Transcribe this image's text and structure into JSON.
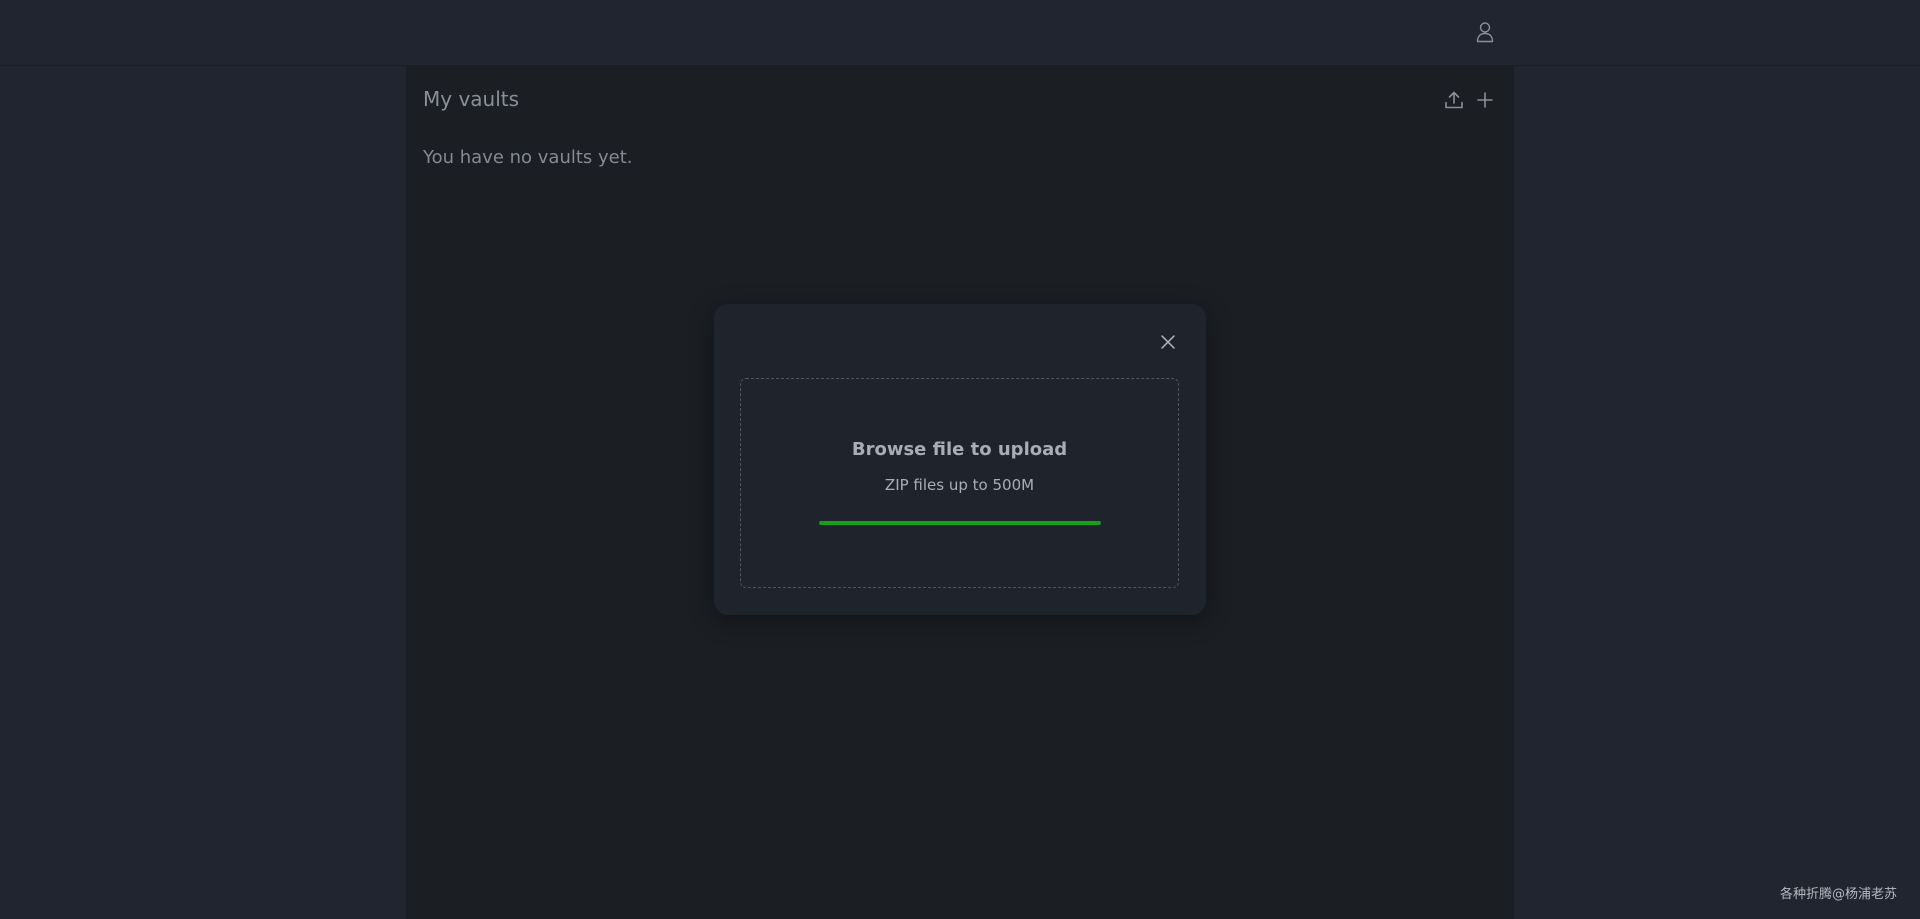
{
  "header": {
    "user_icon": "user-icon"
  },
  "vaults": {
    "title": "My vaults",
    "empty_message": "You have no vaults yet.",
    "upload_icon": "upload-icon",
    "add_icon": "plus-icon"
  },
  "upload_modal": {
    "close_icon": "close-icon",
    "title": "Browse file to upload",
    "subtitle": "ZIP files up to 500M",
    "progress": 1.0,
    "progress_color": "#14a01a"
  },
  "colors": {
    "background": "#212530",
    "panel": "#1b1e22",
    "modal": "#1f232b"
  },
  "watermark": "各种折腾@杨浦老苏"
}
